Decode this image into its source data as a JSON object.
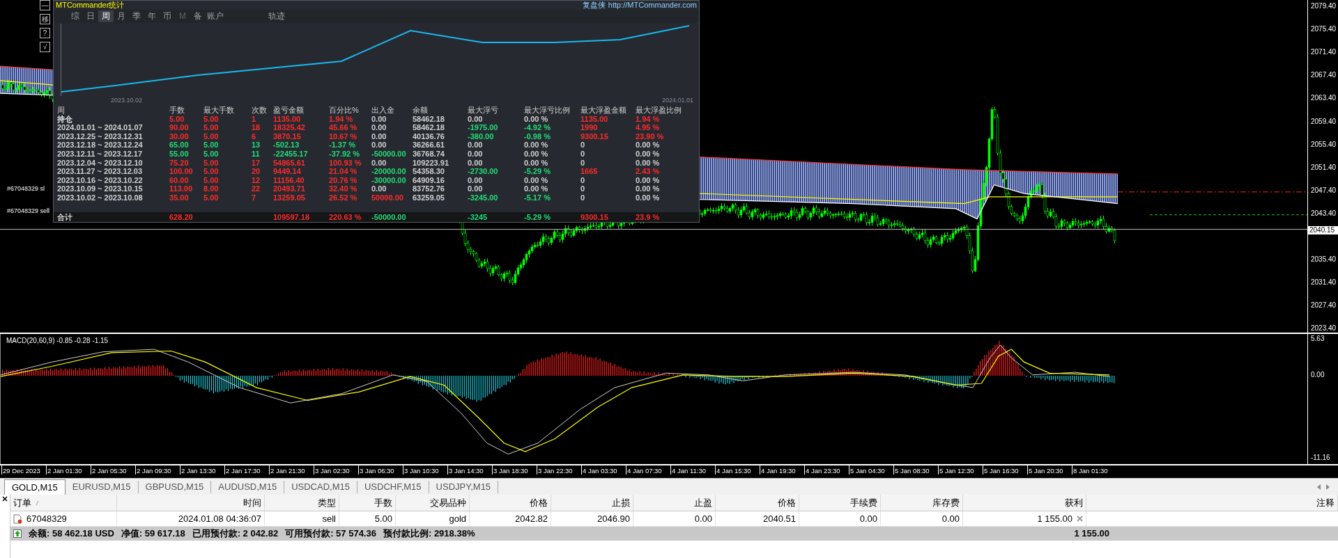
{
  "chart": {
    "tool_buttons": [
      "—",
      "移",
      "?",
      "√"
    ],
    "price_labels": [
      "2079.40",
      "2075.40",
      "2071.40",
      "2067.40",
      "2063.40",
      "2059.40",
      "2055.40",
      "2051.40",
      "2047.40",
      "2043.40",
      "2035.40",
      "2031.40",
      "2027.40",
      "2023.40"
    ],
    "current_price": "2040.15",
    "order_lines": [
      "#67048329 sl",
      "#67048329 sell"
    ]
  },
  "macd": {
    "label": "MACD(20,60,9) -0.85 -0.28 -1.15",
    "axis_labels": [
      "5.63",
      "0.00",
      "-11.16"
    ]
  },
  "time_axis": [
    "29 Dec 2023",
    "2 Jan 01:30",
    "2 Jan 05:30",
    "2 Jan 09:30",
    "2 Jan 13:30",
    "2 Jan 17:30",
    "2 Jan 21:30",
    "3 Jan 02:30",
    "3 Jan 06:30",
    "3 Jan 10:30",
    "3 Jan 14:30",
    "3 Jan 18:30",
    "3 Jan 22:30",
    "4 Jan 03:30",
    "4 Jan 07:30",
    "4 Jan 11:30",
    "4 Jan 15:30",
    "4 Jan 19:30",
    "4 Jan 23:30",
    "5 Jan 04:30",
    "5 Jan 08:30",
    "5 Jan 12:30",
    "5 Jan 16:30",
    "5 Jan 20:30",
    "8 Jan 01:30"
  ],
  "stats_panel": {
    "title": "MTCommander统计",
    "author": "复盘侠",
    "link": "http://MTCommander.com",
    "tabs": [
      {
        "label": "综",
        "selected": false,
        "disabled": false
      },
      {
        "label": "日",
        "selected": false,
        "disabled": false
      },
      {
        "label": "周",
        "selected": true,
        "disabled": false
      },
      {
        "label": "月",
        "selected": false,
        "disabled": false
      },
      {
        "label": "季",
        "selected": false,
        "disabled": false
      },
      {
        "label": "年",
        "selected": false,
        "disabled": false
      },
      {
        "label": "币",
        "selected": false,
        "disabled": false
      },
      {
        "label": "M",
        "selected": false,
        "disabled": true
      },
      {
        "label": "备",
        "selected": false,
        "disabled": false
      },
      {
        "label": "账户",
        "selected": false,
        "disabled": false
      }
    ],
    "track_tab": "轨迹",
    "equity_chart": {
      "start_label": "2023.10.02",
      "end_label": "2024.01.01"
    },
    "table": {
      "columns": [
        "周",
        "手数",
        "最大手数",
        "次数",
        "盈亏金额",
        "百分比%",
        "出入金",
        "余额",
        "最大浮亏",
        "最大浮亏比例",
        "最大浮盈金额",
        "最大浮盈比例"
      ],
      "rows": [
        {
          "cells": [
            {
              "text": "持仓",
              "color": "#e8e8e8"
            },
            {
              "text": "5.00",
              "color": "#ff2a2a"
            },
            {
              "text": "5.00",
              "color": "#ff2a2a"
            },
            {
              "text": "1",
              "color": "#ff2a2a"
            },
            {
              "text": "1135.00",
              "color": "#ff2a2a"
            },
            {
              "text": "1.94 %",
              "color": "#ff2a2a"
            },
            {
              "text": "0.00",
              "color": "#d0d0d0"
            },
            {
              "text": "58462.18",
              "color": "#d0d0d0"
            },
            {
              "text": "0.00",
              "color": "#d0d0d0"
            },
            {
              "text": "0.00 %",
              "color": "#d0d0d0"
            },
            {
              "text": "1135.00",
              "color": "#ff2a2a"
            },
            {
              "text": "1.94 %",
              "color": "#ff2a2a"
            }
          ]
        },
        {
          "cells": [
            {
              "text": "2024.01.01 ~ 2024.01.07",
              "color": "#d0d0d0"
            },
            {
              "text": "90.00",
              "color": "#ff2a2a"
            },
            {
              "text": "5.00",
              "color": "#ff2a2a"
            },
            {
              "text": "18",
              "color": "#ff2a2a"
            },
            {
              "text": "18325.42",
              "color": "#ff2a2a"
            },
            {
              "text": "45.66 %",
              "color": "#ff2a2a"
            },
            {
              "text": "0.00",
              "color": "#d0d0d0"
            },
            {
              "text": "58462.18",
              "color": "#d0d0d0"
            },
            {
              "text": "-1975.00",
              "color": "#22dd77"
            },
            {
              "text": "-4.92 %",
              "color": "#22dd77"
            },
            {
              "text": "1990",
              "color": "#ff2a2a"
            },
            {
              "text": "4.95 %",
              "color": "#ff2a2a"
            }
          ]
        },
        {
          "cells": [
            {
              "text": "2023.12.25 ~ 2023.12.31",
              "color": "#d0d0d0"
            },
            {
              "text": "30.00",
              "color": "#ff2a2a"
            },
            {
              "text": "5.00",
              "color": "#ff2a2a"
            },
            {
              "text": "6",
              "color": "#ff2a2a"
            },
            {
              "text": "3870.15",
              "color": "#ff2a2a"
            },
            {
              "text": "10.67 %",
              "color": "#ff2a2a"
            },
            {
              "text": "0.00",
              "color": "#d0d0d0"
            },
            {
              "text": "40136.76",
              "color": "#d0d0d0"
            },
            {
              "text": "-380.00",
              "color": "#22dd77"
            },
            {
              "text": "-0.98 %",
              "color": "#22dd77"
            },
            {
              "text": "9300.15",
              "color": "#ff2a2a"
            },
            {
              "text": "23.90 %",
              "color": "#ff2a2a"
            }
          ]
        },
        {
          "cells": [
            {
              "text": "2023.12.18 ~ 2023.12.24",
              "color": "#d0d0d0"
            },
            {
              "text": "65.00",
              "color": "#22dd77"
            },
            {
              "text": "5.00",
              "color": "#22dd77"
            },
            {
              "text": "13",
              "color": "#22dd77"
            },
            {
              "text": "-502.13",
              "color": "#22dd77"
            },
            {
              "text": "-1.37 %",
              "color": "#22dd77"
            },
            {
              "text": "0.00",
              "color": "#d0d0d0"
            },
            {
              "text": "36266.61",
              "color": "#d0d0d0"
            },
            {
              "text": "0.00",
              "color": "#d0d0d0"
            },
            {
              "text": "0.00 %",
              "color": "#d0d0d0"
            },
            {
              "text": "0",
              "color": "#d0d0d0"
            },
            {
              "text": "0.00 %",
              "color": "#d0d0d0"
            }
          ]
        },
        {
          "cells": [
            {
              "text": "2023.12.11 ~ 2023.12.17",
              "color": "#d0d0d0"
            },
            {
              "text": "55.00",
              "color": "#22dd77"
            },
            {
              "text": "5.00",
              "color": "#22dd77"
            },
            {
              "text": "11",
              "color": "#22dd77"
            },
            {
              "text": "-22455.17",
              "color": "#22dd77"
            },
            {
              "text": "-37.92 %",
              "color": "#22dd77"
            },
            {
              "text": "-50000.00",
              "color": "#22dd77"
            },
            {
              "text": "36768.74",
              "color": "#d0d0d0"
            },
            {
              "text": "0.00",
              "color": "#d0d0d0"
            },
            {
              "text": "0.00 %",
              "color": "#d0d0d0"
            },
            {
              "text": "0",
              "color": "#d0d0d0"
            },
            {
              "text": "0.00 %",
              "color": "#d0d0d0"
            }
          ]
        },
        {
          "cells": [
            {
              "text": "2023.12.04 ~ 2023.12.10",
              "color": "#d0d0d0"
            },
            {
              "text": "75.20",
              "color": "#ff2a2a"
            },
            {
              "text": "5.00",
              "color": "#ff2a2a"
            },
            {
              "text": "17",
              "color": "#ff2a2a"
            },
            {
              "text": "54865.61",
              "color": "#ff2a2a"
            },
            {
              "text": "100.93 %",
              "color": "#ff2a2a"
            },
            {
              "text": "0.00",
              "color": "#d0d0d0"
            },
            {
              "text": "109223.91",
              "color": "#d0d0d0"
            },
            {
              "text": "0.00",
              "color": "#d0d0d0"
            },
            {
              "text": "0.00 %",
              "color": "#d0d0d0"
            },
            {
              "text": "0",
              "color": "#d0d0d0"
            },
            {
              "text": "0.00 %",
              "color": "#d0d0d0"
            }
          ]
        },
        {
          "cells": [
            {
              "text": "2023.11.27 ~ 2023.12.03",
              "color": "#d0d0d0"
            },
            {
              "text": "100.00",
              "color": "#ff2a2a"
            },
            {
              "text": "5.00",
              "color": "#ff2a2a"
            },
            {
              "text": "20",
              "color": "#ff2a2a"
            },
            {
              "text": "9449.14",
              "color": "#ff2a2a"
            },
            {
              "text": "21.04 %",
              "color": "#ff2a2a"
            },
            {
              "text": "-20000.00",
              "color": "#22dd77"
            },
            {
              "text": "54358.30",
              "color": "#d0d0d0"
            },
            {
              "text": "-2730.00",
              "color": "#22dd77"
            },
            {
              "text": "-5.29 %",
              "color": "#22dd77"
            },
            {
              "text": "1665",
              "color": "#ff2a2a"
            },
            {
              "text": "2.43 %",
              "color": "#ff2a2a"
            }
          ]
        },
        {
          "cells": [
            {
              "text": "2023.10.16 ~ 2023.10.22",
              "color": "#d0d0d0"
            },
            {
              "text": "60.00",
              "color": "#ff2a2a"
            },
            {
              "text": "5.00",
              "color": "#ff2a2a"
            },
            {
              "text": "12",
              "color": "#ff2a2a"
            },
            {
              "text": "11156.40",
              "color": "#ff2a2a"
            },
            {
              "text": "20.76 %",
              "color": "#ff2a2a"
            },
            {
              "text": "-30000.00",
              "color": "#22dd77"
            },
            {
              "text": "64909.16",
              "color": "#d0d0d0"
            },
            {
              "text": "0.00",
              "color": "#d0d0d0"
            },
            {
              "text": "0.00 %",
              "color": "#d0d0d0"
            },
            {
              "text": "0",
              "color": "#d0d0d0"
            },
            {
              "text": "0.00 %",
              "color": "#d0d0d0"
            }
          ]
        },
        {
          "cells": [
            {
              "text": "2023.10.09 ~ 2023.10.15",
              "color": "#d0d0d0"
            },
            {
              "text": "113.00",
              "color": "#ff2a2a"
            },
            {
              "text": "8.00",
              "color": "#ff2a2a"
            },
            {
              "text": "22",
              "color": "#ff2a2a"
            },
            {
              "text": "20493.71",
              "color": "#ff2a2a"
            },
            {
              "text": "32.40 %",
              "color": "#ff2a2a"
            },
            {
              "text": "0.00",
              "color": "#d0d0d0"
            },
            {
              "text": "83752.76",
              "color": "#d0d0d0"
            },
            {
              "text": "0.00",
              "color": "#d0d0d0"
            },
            {
              "text": "0.00 %",
              "color": "#d0d0d0"
            },
            {
              "text": "0",
              "color": "#d0d0d0"
            },
            {
              "text": "0.00 %",
              "color": "#d0d0d0"
            }
          ]
        },
        {
          "cells": [
            {
              "text": "2023.10.02 ~ 2023.10.08",
              "color": "#d0d0d0"
            },
            {
              "text": "35.00",
              "color": "#ff2a2a"
            },
            {
              "text": "5.00",
              "color": "#ff2a2a"
            },
            {
              "text": "7",
              "color": "#ff2a2a"
            },
            {
              "text": "13259.05",
              "color": "#ff2a2a"
            },
            {
              "text": "26.52 %",
              "color": "#ff2a2a"
            },
            {
              "text": "50000.00",
              "color": "#ff2a2a"
            },
            {
              "text": "63259.05",
              "color": "#d0d0d0"
            },
            {
              "text": "-3245.00",
              "color": "#22dd77"
            },
            {
              "text": "-5.17 %",
              "color": "#22dd77"
            },
            {
              "text": "0",
              "color": "#d0d0d0"
            },
            {
              "text": "0.00 %",
              "color": "#d0d0d0"
            }
          ]
        }
      ],
      "total": {
        "cells": [
          {
            "text": "合计",
            "color": "#d0d0d0"
          },
          {
            "text": "628.20",
            "color": "#ff2a2a"
          },
          null,
          null,
          {
            "text": "109597.18",
            "color": "#ff2a2a"
          },
          {
            "text": "220.63 %",
            "color": "#ff2a2a"
          },
          {
            "text": "-50000.00",
            "color": "#22dd77"
          },
          null,
          {
            "text": "-3245",
            "color": "#22dd77"
          },
          {
            "text": "-5.29 %",
            "color": "#22dd77"
          },
          {
            "text": "9300.15",
            "color": "#ff2a2a"
          },
          {
            "text": "23.9 %",
            "color": "#ff2a2a"
          }
        ]
      }
    }
  },
  "symbol_tabs": [
    {
      "label": "GOLD,M15",
      "selected": true
    },
    {
      "label": "EURUSD,M15",
      "selected": false
    },
    {
      "label": "GBPUSD,M15",
      "selected": false
    },
    {
      "label": "AUDUSD,M15",
      "selected": false
    },
    {
      "label": "USDCAD,M15",
      "selected": false
    },
    {
      "label": "USDCHF,M15",
      "selected": false
    },
    {
      "label": "USDJPY,M15",
      "selected": false
    }
  ],
  "orders": {
    "columns": [
      "订单",
      "时间",
      "类型",
      "手数",
      "交易品种",
      "价格",
      "止损",
      "止盈",
      "价格",
      "手续费",
      "库存费",
      "获利",
      "注释"
    ],
    "rows": [
      {
        "cells": [
          "67048329",
          "2024.01.08 04:36:07",
          "sell",
          "5.00",
          "gold",
          "2042.82",
          "2046.90",
          "0.00",
          "2040.51",
          "0.00",
          "0.00",
          "1 155.00"
        ]
      }
    ],
    "summary": {
      "items": [
        "余额: 58 462.18 USD",
        "净值: 59 617.18",
        "已用预付款: 2 042.82",
        "可用预付款: 57 574.36",
        "预付款比例: 2918.38%"
      ],
      "profit": "1 155.00"
    }
  }
}
